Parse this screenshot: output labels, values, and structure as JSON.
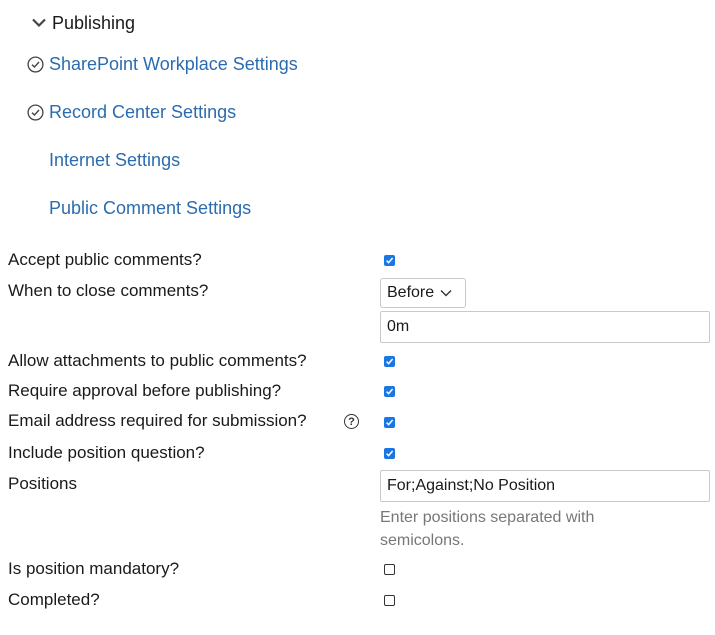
{
  "section": {
    "title": "Publishing"
  },
  "nav": [
    {
      "label": "SharePoint Workplace Settings",
      "icon": "check-circle-icon"
    },
    {
      "label": "Record Center Settings",
      "icon": "check-circle-icon"
    },
    {
      "label": "Internet Settings",
      "icon": null
    },
    {
      "label": "Public Comment Settings",
      "icon": null
    }
  ],
  "form": {
    "accept_public_comments": {
      "label": "Accept public comments?",
      "checked": true
    },
    "when_to_close": {
      "label": "When to close comments?",
      "select_value": "Before",
      "input_value": "0m"
    },
    "allow_attachments": {
      "label": "Allow attachments to public comments?",
      "checked": true
    },
    "require_approval": {
      "label": "Require approval before publishing?",
      "checked": true
    },
    "email_required": {
      "label": "Email address required for submission?",
      "checked": true,
      "help_icon": "?"
    },
    "include_position": {
      "label": "Include position question?",
      "checked": true
    },
    "positions": {
      "label": "Positions",
      "value": "For;Against;No Position",
      "hint": "Enter positions separated with semicolons."
    },
    "position_mandatory": {
      "label": "Is position mandatory?",
      "checked": false
    },
    "completed": {
      "label": "Completed?",
      "checked": false
    }
  },
  "colors": {
    "link": "#2b6cb0",
    "checkbox": "#1976e5"
  }
}
